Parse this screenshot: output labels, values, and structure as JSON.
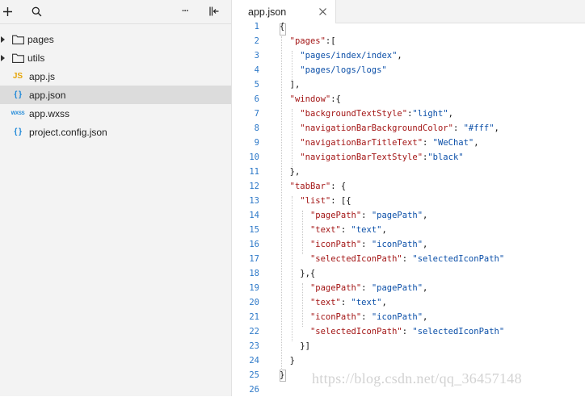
{
  "sidebar": {
    "items": [
      {
        "label": "pages",
        "type": "folder",
        "icon": "folder-icon"
      },
      {
        "label": "utils",
        "type": "folder",
        "icon": "folder-icon"
      },
      {
        "label": "app.js",
        "type": "file",
        "icon": "js-file-icon",
        "badge": "JS"
      },
      {
        "label": "app.json",
        "type": "file",
        "icon": "json-file-icon",
        "badge": "{ }",
        "selected": true
      },
      {
        "label": "app.wxss",
        "type": "file",
        "icon": "wxss-file-icon",
        "badge": "WXSS"
      },
      {
        "label": "project.config.json",
        "type": "file",
        "icon": "json-file-icon",
        "badge": "{ }"
      }
    ]
  },
  "toolbar": {
    "more_label": "···"
  },
  "editor": {
    "tab": {
      "title": "app.json"
    },
    "line_numbers": [
      "1",
      "2",
      "3",
      "4",
      "5",
      "6",
      "7",
      "8",
      "9",
      "10",
      "11",
      "12",
      "13",
      "14",
      "15",
      "16",
      "17",
      "18",
      "19",
      "20",
      "21",
      "22",
      "23",
      "24",
      "25",
      "26"
    ],
    "code_lines": [
      "{",
      "  \"pages\":[",
      "    \"pages/index/index\",",
      "    \"pages/logs/logs\"",
      "  ],",
      "  \"window\":{",
      "    \"backgroundTextStyle\":\"light\",",
      "    \"navigationBarBackgroundColor\": \"#fff\",",
      "    \"navigationBarTitleText\": \"WeChat\",",
      "    \"navigationBarTextStyle\":\"black\"",
      "  },",
      "  \"tabBar\": {",
      "    \"list\": [{",
      "      \"pagePath\": \"pagePath\",",
      "      \"text\": \"text\",",
      "      \"iconPath\": \"iconPath\",",
      "      \"selectedIconPath\": \"selectedIconPath\"",
      "    },{",
      "      \"pagePath\": \"pagePath\",",
      "      \"text\": \"text\",",
      "      \"iconPath\": \"iconPath\",",
      "      \"selectedIconPath\": \"selectedIconPath\"",
      "    }]",
      "  }",
      "}",
      ""
    ]
  },
  "watermark": "https://blog.csdn.net/qq_36457148",
  "colors": {
    "keyword": "#a31515",
    "string": "#0b4fa8",
    "line_number": "#2c78c8",
    "accent": "#1e88d8"
  }
}
